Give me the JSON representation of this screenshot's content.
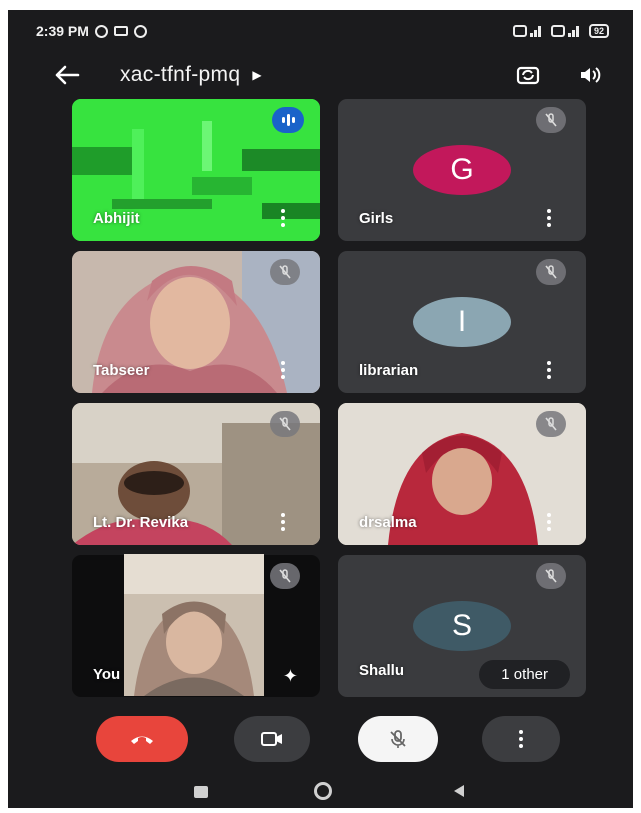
{
  "status_bar": {
    "time": "2:39 PM",
    "battery": "92",
    "icons": [
      "whatsapp-icon",
      "cast-icon",
      "vpn-icon",
      "sim1-signal-icon",
      "sim2-signal-icon"
    ]
  },
  "app_bar": {
    "meeting_code": "xac-tfnf-pmq",
    "icons": [
      "back-arrow-icon",
      "dropdown-caret-icon",
      "switch-camera-icon",
      "speaker-icon"
    ]
  },
  "participants": [
    {
      "name": "Abhijit",
      "state": "speaking",
      "video": true
    },
    {
      "name": "Girls",
      "initial": "G",
      "avatar_color": "#c2185b",
      "muted": true
    },
    {
      "name": "Tabseer",
      "video": true,
      "muted": true
    },
    {
      "name": "librarian",
      "initial": "I",
      "avatar_color": "#8ba6b2",
      "muted": true
    },
    {
      "name": "Lt. Dr. Revika",
      "video": true,
      "muted": true
    },
    {
      "name": "drsalma",
      "video": true,
      "muted": true
    },
    {
      "name": "You",
      "video": true,
      "muted": true,
      "effects_icon": "sparkle-effects-icon"
    },
    {
      "name": "Shallu",
      "initial": "S",
      "avatar_color": "#3f5a66",
      "muted": true,
      "overflow_label": "1 other"
    }
  ],
  "controls": {
    "items": [
      "end-call-icon",
      "camera-icon",
      "mic-off-icon",
      "more-options-icon"
    ],
    "end_call_color": "#e8453c"
  },
  "nav_bar": {
    "items": [
      "recents-icon",
      "home-icon",
      "back-icon"
    ]
  },
  "colors": {
    "background": "#1b1b1d",
    "tile": "#3a3b3e",
    "speaking_badge": "#1a63c9"
  }
}
